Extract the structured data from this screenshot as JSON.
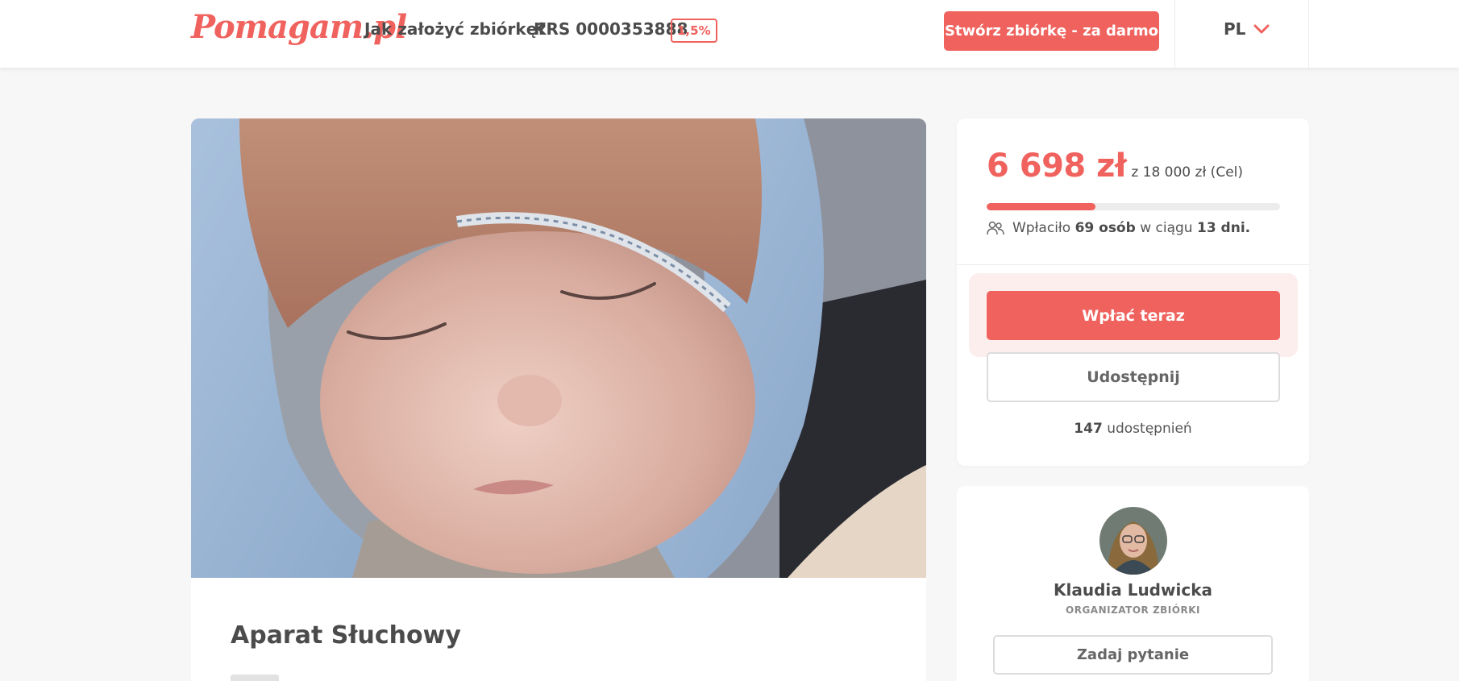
{
  "header": {
    "logo": "Pomagam.pl",
    "how_to_label": "Jak założyć zbiórkę?",
    "krs_label": "KRS 0000353888",
    "krs_badge": "1,5%",
    "create_label": "Stwórz zbiórkę - za darmo",
    "lang_label": "PL",
    "lang_icon": "chevron-down-icon"
  },
  "main": {
    "photo_icon": "sleeping-baby-photo",
    "title": "Aparat Słuchowy"
  },
  "donation": {
    "amount": "6 698 zł",
    "goal_text": "z 18 000 zł (Cel)",
    "progress_fraction": 0.37,
    "people_icon": "users-icon",
    "donated_prefix": "Wpłaciło",
    "donors": "69 osób",
    "within_text": "w ciągu",
    "days": "13 dni.",
    "pay_label": "Wpłać teraz",
    "share_label": "Udostępnij",
    "share_count": "147",
    "share_suffix": "udostępnień"
  },
  "organizer": {
    "name": "Klaudia Ludwicka",
    "role": "ORGANIZATOR ZBIÓRKI",
    "ask_label": "Zadaj pytanie"
  },
  "colors": {
    "accent": "#f0625e",
    "background": "#f7f7f8",
    "text": "#4b4b4b"
  }
}
